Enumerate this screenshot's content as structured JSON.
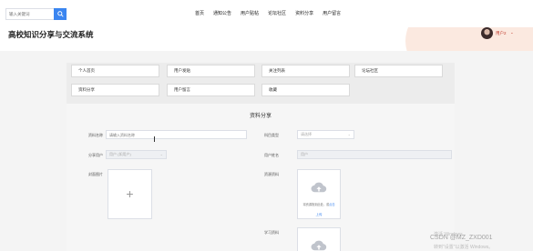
{
  "search": {
    "placeholder": "输入关键词"
  },
  "nav": {
    "items": [
      "首页",
      "通知公告",
      "用户贴帖",
      "论坛社区",
      "资料分享",
      "用户留言"
    ]
  },
  "header": {
    "site_title": "高校知识分享与交流系统",
    "user_name": "用户2",
    "caret": "⌄"
  },
  "menu": {
    "row1": [
      "个人首页",
      "用户发贴",
      "关注列表",
      "论坛社区"
    ],
    "row2": [
      "资料分享",
      "用户留言",
      "收藏"
    ]
  },
  "page": {
    "title": "资料分享"
  },
  "form": {
    "name_label": "资料名称",
    "name_placeholder": "请输入资料名称",
    "type_label": "科目类型",
    "type_placeholder": "请选择",
    "share_user_label": "分享用户",
    "share_user_value": "用户 (如用户)",
    "user_name_label": "用户姓名",
    "user_name_value": "用户",
    "cover_label": "封面图片",
    "file_label": "资源资料",
    "file_label2": "学习资料"
  },
  "upload": {
    "tip_prefix": "将资源拖到此处，或",
    "tip_link": "点击",
    "link": "上传"
  },
  "overlay": {
    "watermark": "CSDN @MZ_ZXD001",
    "win1": "激活 Windows",
    "win2": "转到\"设置\"以激活 Windows。"
  },
  "colors": {
    "accent": "#3a85f0",
    "user": "#c0392b"
  }
}
